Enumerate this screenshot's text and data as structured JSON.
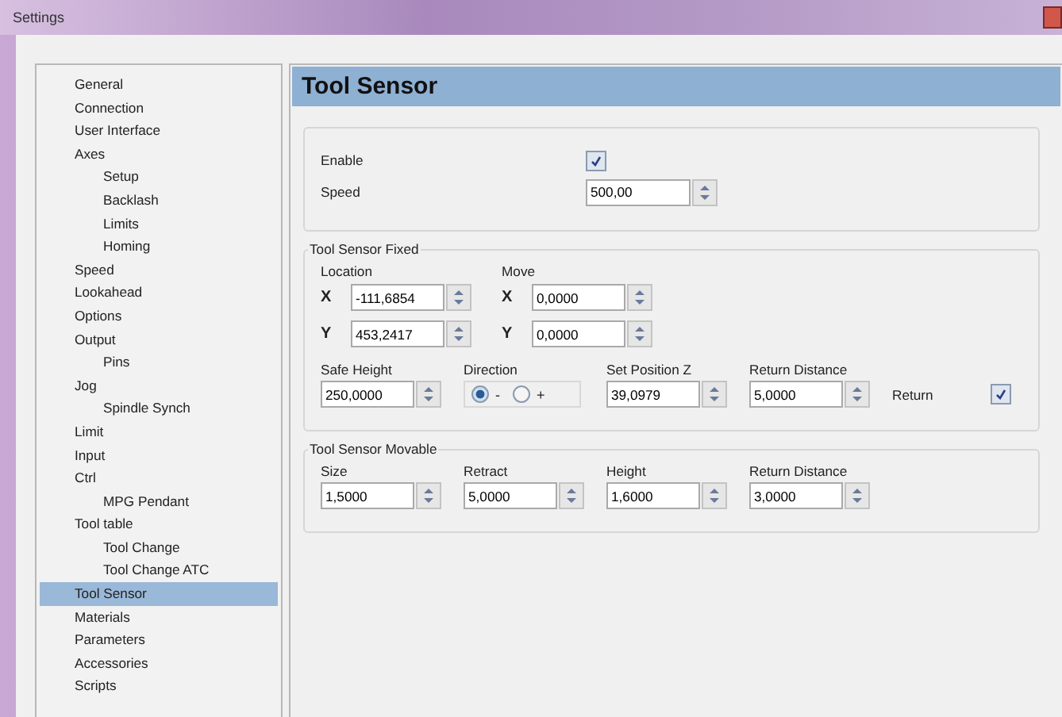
{
  "window": {
    "title": "Settings"
  },
  "sidebar": {
    "items": [
      {
        "label": "General",
        "selected": false
      },
      {
        "label": "Connection",
        "selected": false
      },
      {
        "label": "User Interface",
        "selected": false
      },
      {
        "label": "Axes",
        "selected": false,
        "children": [
          {
            "label": "Setup",
            "selected": false
          },
          {
            "label": "Backlash",
            "selected": false
          },
          {
            "label": "Limits",
            "selected": false
          },
          {
            "label": "Homing",
            "selected": false
          }
        ]
      },
      {
        "label": "Speed",
        "selected": false
      },
      {
        "label": "Lookahead",
        "selected": false
      },
      {
        "label": "Options",
        "selected": false
      },
      {
        "label": "Output",
        "selected": false,
        "children": [
          {
            "label": "Pins",
            "selected": false
          }
        ]
      },
      {
        "label": "Jog",
        "selected": false,
        "children": [
          {
            "label": "Spindle Synch",
            "selected": false
          }
        ]
      },
      {
        "label": "Limit",
        "selected": false
      },
      {
        "label": "Input",
        "selected": false
      },
      {
        "label": "Ctrl",
        "selected": false,
        "children": [
          {
            "label": "MPG Pendant",
            "selected": false
          }
        ]
      },
      {
        "label": "Tool table",
        "selected": false,
        "children": [
          {
            "label": "Tool Change",
            "selected": false
          },
          {
            "label": "Tool Change ATC",
            "selected": false
          }
        ]
      },
      {
        "label": "Tool Sensor",
        "selected": true
      },
      {
        "label": "Materials",
        "selected": false
      },
      {
        "label": "Parameters",
        "selected": false
      },
      {
        "label": "Accessories",
        "selected": false
      },
      {
        "label": "Scripts",
        "selected": false
      }
    ]
  },
  "header": "Tool Sensor",
  "general": {
    "enable": {
      "label": "Enable",
      "checked": true
    },
    "speed": {
      "label": "Speed",
      "value": "500,00"
    }
  },
  "fixed": {
    "title": "Tool Sensor Fixed",
    "location_label": "Location",
    "move_label": "Move",
    "location": [
      {
        "axis": "X",
        "value": "-111,6854"
      },
      {
        "axis": "Y",
        "value": "453,2417"
      }
    ],
    "move": [
      {
        "axis": "X",
        "value": "0,0000"
      },
      {
        "axis": "Y",
        "value": "0,0000"
      }
    ],
    "safe_height": {
      "label": "Safe Height",
      "value": "250,0000"
    },
    "direction": {
      "label": "Direction",
      "options": [
        {
          "label": "-",
          "selected": true
        },
        {
          "label": "+",
          "selected": false
        }
      ]
    },
    "set_position_z": {
      "label": "Set Position Z",
      "value": "39,0979"
    },
    "return_distance": {
      "label": "Return Distance",
      "value": "5,0000"
    },
    "return": {
      "label": "Return",
      "checked": true
    }
  },
  "movable": {
    "title": "Tool Sensor Movable",
    "fields": [
      {
        "label": "Size",
        "value": "1,5000"
      },
      {
        "label": "Retract",
        "value": "5,0000"
      },
      {
        "label": "Height",
        "value": "1,6000"
      },
      {
        "label": "Return Distance",
        "value": "3,0000"
      }
    ]
  }
}
